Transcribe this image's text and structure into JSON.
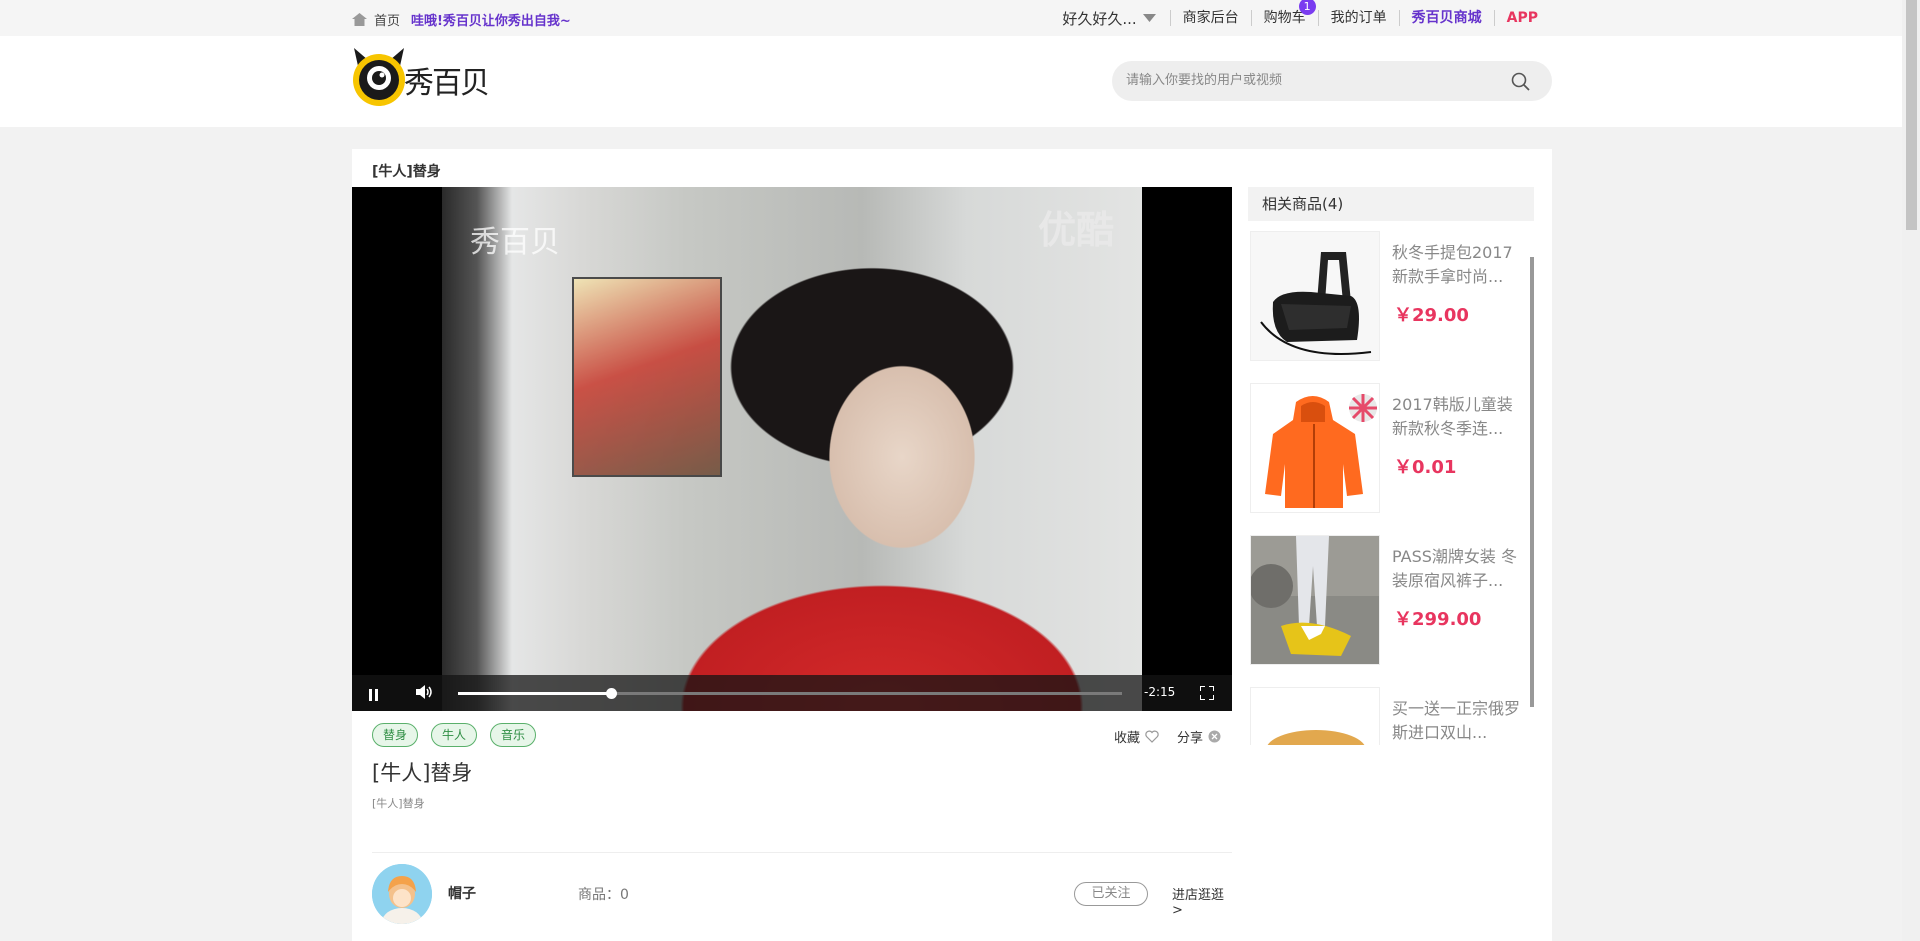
{
  "topbar": {
    "home": "首页",
    "slogan": "哇哦!秀百贝让你秀出自我~",
    "user": "好久好久...",
    "links": [
      "商家后台",
      "购物车",
      "我的订单",
      "秀百贝商城",
      "APP"
    ],
    "cart_count": "1"
  },
  "header": {
    "logo_text": "秀百贝",
    "search_placeholder": "请输入你要找的用户或视频"
  },
  "breadcrumb": "[牛人]替身",
  "video": {
    "watermark_right": "优酷",
    "watermark_left": "秀百贝",
    "time": "-2:15",
    "progress": 0.23
  },
  "tags": [
    "替身",
    "牛人",
    "音乐"
  ],
  "actions": {
    "favorite": "收藏",
    "share": "分享"
  },
  "title": "[牛人]替身",
  "description": "[牛人]替身",
  "author": {
    "name": "帽子",
    "goods_label": "商品：0",
    "follow": "已关注",
    "shop": "进店逛逛>"
  },
  "related": {
    "heading": "相关商品(4)",
    "items": [
      {
        "name": "秋冬手提包2017新款手拿时尚...",
        "price": "￥29.00"
      },
      {
        "name": "2017韩版儿童装新款秋冬季连...",
        "price": "￥0.01"
      },
      {
        "name": "PASS潮牌女装 冬装原宿风裤子...",
        "price": "￥299.00"
      },
      {
        "name": "买一送一正宗俄罗斯进口双山...",
        "price": ""
      }
    ]
  }
}
